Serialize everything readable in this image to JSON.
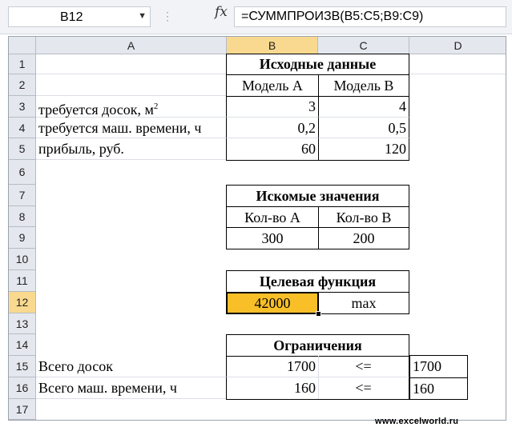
{
  "formula_bar": {
    "name_box": "B12",
    "fx_icon": "fx-icon",
    "formula": "=СУММПРОИЗВ(B5:C5;B9:C9)"
  },
  "columns": [
    "A",
    "B",
    "C",
    "D"
  ],
  "rows": [
    "1",
    "2",
    "3",
    "4",
    "5",
    "6",
    "7",
    "8",
    "9",
    "10",
    "11",
    "12",
    "13",
    "14",
    "15",
    "16",
    "17"
  ],
  "cells": {
    "B1": "Исходные данные",
    "B2": "Модель A",
    "C2": "Модель B",
    "A3": "требуется досок, м",
    "A3_sup": "2",
    "B3": "3",
    "C3": "4",
    "A4": "требуется маш. времени, ч",
    "B4": "0,2",
    "C4": "0,5",
    "A5": "прибыль, руб.",
    "B5": "60",
    "C5": "120",
    "B7": "Искомые значения",
    "B8": "Кол-во А",
    "C8": "Кол-во В",
    "B9": "300",
    "C9": "200",
    "B11": "Целевая функция",
    "B12": "42000",
    "C12": "max",
    "B14": "Ограничения",
    "A15": "Всего досок",
    "B15": "1700",
    "C15": "<=",
    "D15": "1700",
    "A16": "Всего маш. времени, ч",
    "B16": "160",
    "C16": "<=",
    "D16": "160"
  },
  "watermark": "www.excelworld.ru",
  "colors": {
    "selected_cell": "#f8bf29",
    "header_highlight": "#f9d98f",
    "header_bg": "#e4e8ee"
  }
}
